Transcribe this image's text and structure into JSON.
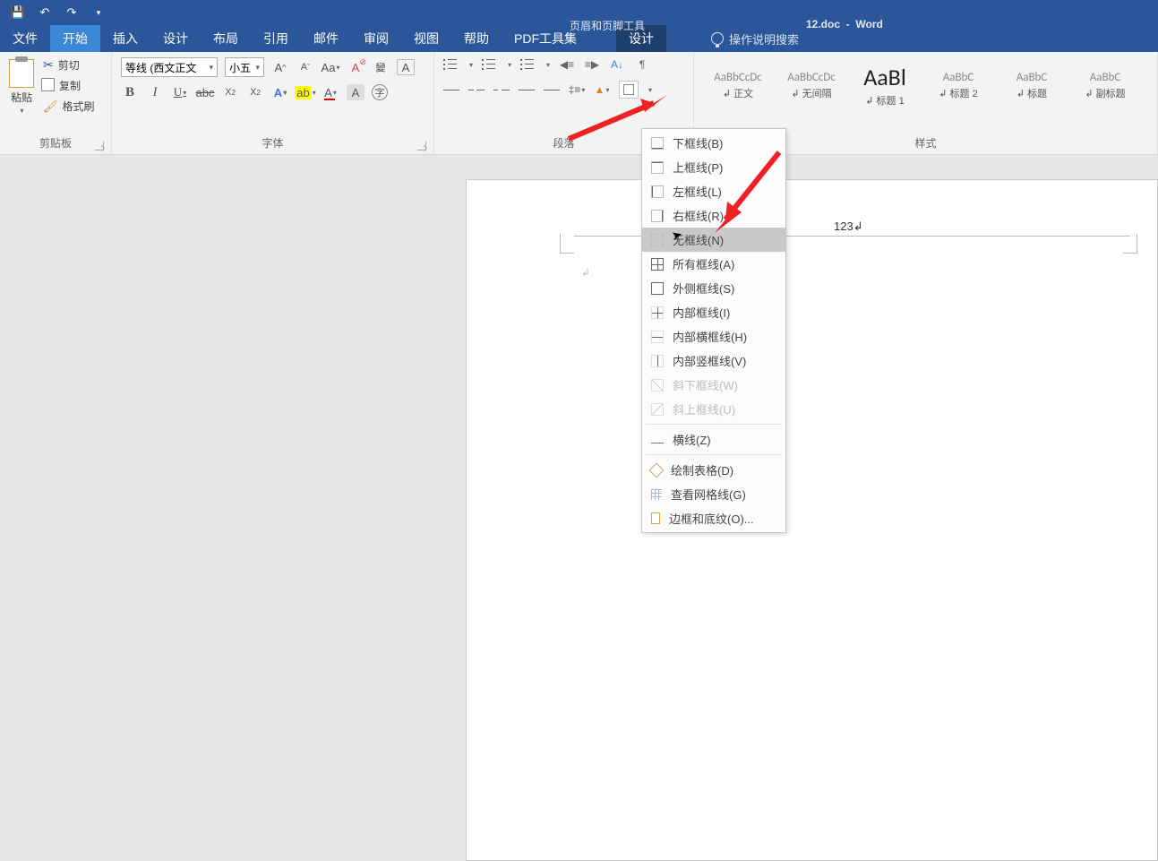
{
  "title": {
    "doc": "12.doc",
    "app": "Word",
    "context_tool": "页眉和页脚工具"
  },
  "qat": {
    "save": "保存",
    "undo": "撤销",
    "redo": "重做"
  },
  "tabs": {
    "file": "文件",
    "home": "开始",
    "insert": "插入",
    "design_page": "设计",
    "layout": "布局",
    "references": "引用",
    "mail": "邮件",
    "review": "审阅",
    "view": "视图",
    "help": "帮助",
    "pdf": "PDF工具集",
    "context_design": "设计",
    "tellme": "操作说明搜索"
  },
  "ribbon": {
    "clipboard": {
      "label": "剪贴板",
      "paste": "粘贴",
      "cut": "剪切",
      "copy": "复制",
      "format_painter": "格式刷"
    },
    "font": {
      "label": "字体",
      "font_name": "等线 (西文正文",
      "font_size": "小五",
      "grow": "A",
      "shrink": "A",
      "case": "Aa",
      "clear": "A"
    },
    "paragraph": {
      "label": "段落"
    },
    "styles": {
      "label": "样式",
      "items": [
        {
          "preview": "AaBbCcDc",
          "name": "正文",
          "cls": ""
        },
        {
          "preview": "AaBbCcDc",
          "name": "无间隔",
          "cls": ""
        },
        {
          "preview": "AaBl",
          "name": "标题 1",
          "cls": "big"
        },
        {
          "preview": "AaBbC",
          "name": "标题 2",
          "cls": ""
        },
        {
          "preview": "AaBbC",
          "name": "标题",
          "cls": ""
        },
        {
          "preview": "AaBbC",
          "name": "副标题",
          "cls": ""
        }
      ]
    }
  },
  "document": {
    "header_number": "123"
  },
  "border_menu": {
    "items": [
      {
        "label": "下框线(B)",
        "ico": "bord-bottom"
      },
      {
        "label": "上框线(P)",
        "ico": "bord-top"
      },
      {
        "label": "左框线(L)",
        "ico": "bord-left"
      },
      {
        "label": "右框线(R)",
        "ico": "bord-right"
      }
    ],
    "none": "无框线(N)",
    "group2": [
      {
        "label": "所有框线(A)",
        "ico": "bord-all"
      },
      {
        "label": "外侧框线(S)",
        "ico": "bord-out"
      },
      {
        "label": "内部框线(I)",
        "ico": "bord-in"
      },
      {
        "label": "内部横框线(H)",
        "ico": "bord-ih"
      },
      {
        "label": "内部竖框线(V)",
        "ico": "bord-iv"
      }
    ],
    "diag": [
      {
        "label": "斜下框线(W)",
        "ico": "diag1"
      },
      {
        "label": "斜上框线(U)",
        "ico": "diag2"
      }
    ],
    "hline": "横线(Z)",
    "bottom": [
      {
        "label": "绘制表格(D)",
        "ico": "pencil"
      },
      {
        "label": "查看网格线(G)",
        "ico": "grid-ico"
      },
      {
        "label": "边框和底纹(O)...",
        "ico": "page-ico"
      }
    ]
  }
}
